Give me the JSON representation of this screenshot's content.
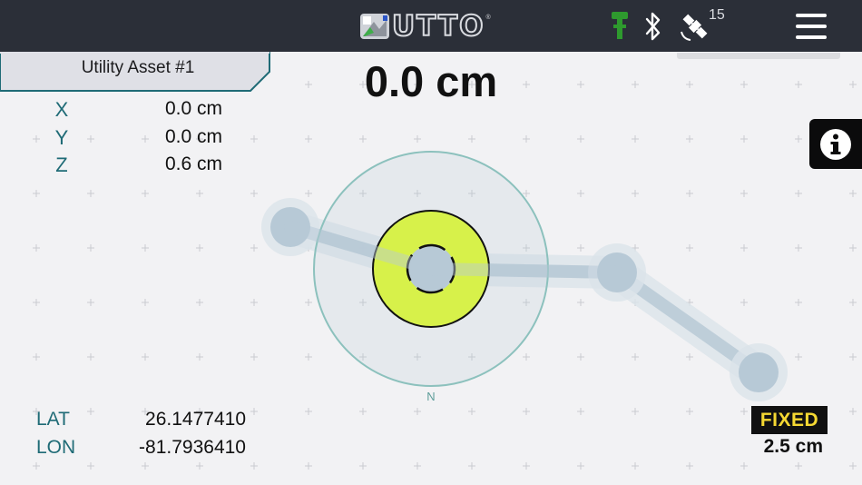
{
  "header": {
    "logo_text": "UTTO",
    "logo_reg": "®",
    "satellite_count": "15"
  },
  "asset": {
    "title": "Utility Asset #1"
  },
  "readout": {
    "distance": "0.0 cm"
  },
  "offsets": [
    {
      "label": "X",
      "value": "0.0 cm"
    },
    {
      "label": "Y",
      "value": "0.0 cm"
    },
    {
      "label": "Z",
      "value": "0.6 cm"
    }
  ],
  "position": {
    "lat_label": "LAT",
    "lat_value": "26.1477410",
    "lon_label": "LON",
    "lon_value": "-81.7936410"
  },
  "compass": {
    "north_label": "N"
  },
  "fix": {
    "status": "FIXED",
    "accuracy": "2.5 cm"
  },
  "icons": {
    "antenna": "survey-pole-icon",
    "bluetooth": "bluetooth-icon",
    "satellite": "satellite-icon",
    "menu": "hamburger-menu-icon",
    "info": "info-icon"
  },
  "colors": {
    "topbar": "#2b2f38",
    "background": "#f2f2f4",
    "accent_teal": "#1f6b76",
    "target_yellow": "#d7f14a",
    "antenna_green": "#2e9a2e",
    "fix_yellow": "#f5d832",
    "path_blue": "#b7c9d6"
  }
}
